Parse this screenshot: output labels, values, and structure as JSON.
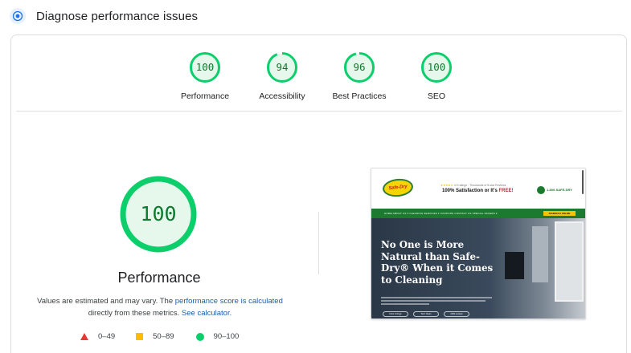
{
  "header": {
    "icon": "lighthouse-audit-icon",
    "title": "Diagnose performance issues"
  },
  "colors": {
    "pass": "#0cce6b",
    "pass_text": "#0c7a2f",
    "pass_fill": "#e6f7ec",
    "average": "#fbbc04",
    "fail": "#e53935",
    "link": "#1a5fb4"
  },
  "gauges": [
    {
      "score": 100,
      "score_text": "100",
      "label": "Performance"
    },
    {
      "score": 94,
      "score_text": "94",
      "label": "Accessibility"
    },
    {
      "score": 96,
      "score_text": "96",
      "label": "Best Practices"
    },
    {
      "score": 100,
      "score_text": "100",
      "label": "SEO"
    }
  ],
  "main": {
    "score": 100,
    "score_text": "100",
    "title": "Performance",
    "desc_prefix": "Values are estimated and may vary. The ",
    "desc_link1": "performance score is calculated",
    "desc_middle": " directly from these metrics. ",
    "desc_link2": "See calculator."
  },
  "legend": [
    {
      "shape": "triangle",
      "range": "0–49"
    },
    {
      "shape": "square",
      "range": "50–89"
    },
    {
      "shape": "circle",
      "range": "90–100"
    }
  ],
  "screenshot": {
    "logo_text": "Safe-Dry",
    "stars": "★★★★★",
    "rating_text": "4.9 ratings · Thousands of 5-star Reviews",
    "satisfaction": "100% Satisfaction or It's ",
    "satisfaction_emph": "FREE!",
    "phone": "1-800-SAFE-DRY",
    "nav_items": "HOME   ABOUT US ▾   CLEANING SERVICES ▾   COUPONS   CONTACT US   SPECIAL OFFERS ▾",
    "cta": "SCHEDULE ONLINE",
    "headline": "No One is More Natural than Safe-Dry® When it Comes to Cleaning",
    "buttons": [
      "Floor & Rugs",
      "Tech Clean",
      "200k reviews"
    ]
  }
}
